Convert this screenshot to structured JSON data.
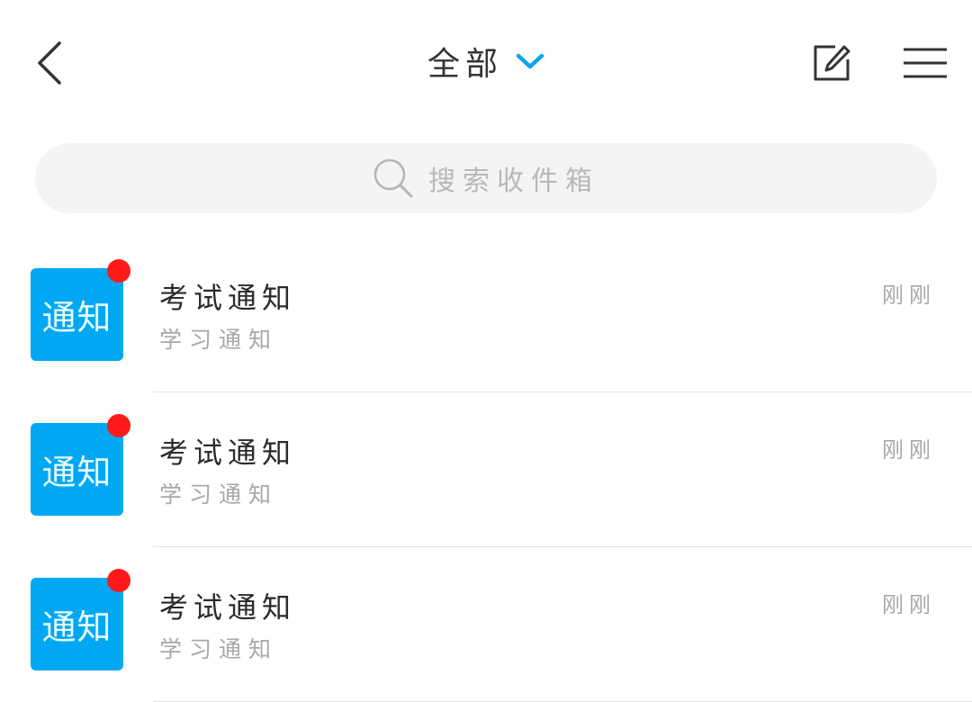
{
  "header": {
    "title": "全部",
    "accent_color": "#0ea5e9",
    "icons": {
      "back": "chevron-left-icon",
      "dropdown": "chevron-down-icon",
      "compose": "compose-icon",
      "menu": "hamburger-menu-icon"
    }
  },
  "search": {
    "placeholder": "搜索收件箱",
    "icon": "search-icon"
  },
  "messages": [
    {
      "avatar_text": "通知",
      "title": "考试通知",
      "subtitle": "学习通知",
      "time": "刚刚",
      "unread": true
    },
    {
      "avatar_text": "通知",
      "title": "考试通知",
      "subtitle": "学习通知",
      "time": "刚刚",
      "unread": true
    },
    {
      "avatar_text": "通知",
      "title": "考试通知",
      "subtitle": "学习通知",
      "time": "刚刚",
      "unread": true
    }
  ],
  "colors": {
    "avatar_bg": "#00a8f4",
    "unread_dot": "#ff1a1a",
    "search_bg": "#f3f4f6"
  }
}
